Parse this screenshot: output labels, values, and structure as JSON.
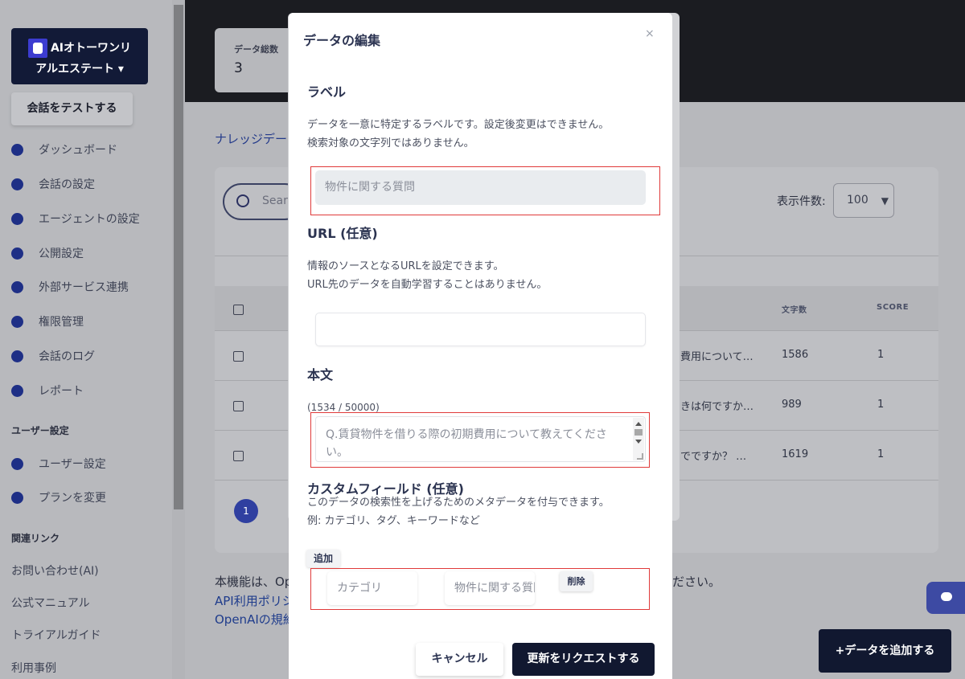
{
  "sidebar": {
    "brand": {
      "line1": "AIオトーワンリ",
      "line2": "アルエステート ▾"
    },
    "test_button": "会話をテストする",
    "items": [
      {
        "label": "ダッシュボード",
        "icon": "pie-chart-icon"
      },
      {
        "label": "会話の設定",
        "icon": "chat-bubble-icon"
      },
      {
        "label": "エージェントの設定",
        "icon": "smiley-icon"
      },
      {
        "label": "公開設定",
        "icon": "globe-icon"
      },
      {
        "label": "外部サービス連携",
        "icon": "link-icon"
      },
      {
        "label": "権限管理",
        "icon": "user-circle-icon"
      },
      {
        "label": "会話のログ",
        "icon": "list-icon"
      },
      {
        "label": "レポート",
        "icon": "compass-icon"
      }
    ],
    "user_section_label": "ユーザー設定",
    "user_items": [
      {
        "label": "ユーザー設定",
        "icon": "bar-chart-icon"
      },
      {
        "label": "プランを変更",
        "icon": "rocket-icon"
      }
    ],
    "related_label": "関連リンク",
    "related_links": [
      "お問い合わせ(AI)",
      "公式マニュアル",
      "トライアルガイド",
      "利用事例"
    ]
  },
  "stats": {
    "label": "データ総数",
    "value": "3"
  },
  "knowledge_title": "ナレッジデー",
  "search": {
    "placeholder": "Sear"
  },
  "per_page": {
    "label": "表示件数:",
    "value": "100"
  },
  "table": {
    "headers": {
      "chars": "文字数",
      "score": "SCORE"
    },
    "rows": [
      {
        "text": "費用について…",
        "chars": "1586",
        "score": "1"
      },
      {
        "text": "きは何ですか…",
        "chars": "989",
        "score": "1"
      },
      {
        "text": "でですか？ …",
        "chars": "1619",
        "score": "1"
      }
    ]
  },
  "pagination": {
    "current": "1"
  },
  "footer": {
    "line1_left": "本機能は、Op",
    "line1_right": "ださい。",
    "link1": "API利用ポリシ",
    "link2": "OpenAIの規約"
  },
  "add_data_button": "+データを追加する",
  "modal": {
    "title": "データの編集",
    "close": "×",
    "label_section": {
      "heading": "ラベル",
      "help1": "データを一意に特定するラベルです。設定後変更はできません。",
      "help2": "検索対象の文字列ではありません。",
      "value": "物件に関する質問"
    },
    "url_section": {
      "heading": "URL (任意)",
      "help1": "情報のソースとなるURLを設定できます。",
      "help2": "URL先のデータを自動学習することはありません。",
      "value": ""
    },
    "body_section": {
      "heading": "本文",
      "count": "(1534 / 50000)",
      "value": "Q.賃貸物件を借りる際の初期費用について教えてください。"
    },
    "custom_section": {
      "heading": "カスタムフィールド (任意)",
      "help1": "このデータの検索性を上げるためのメタデータを付与できます。",
      "help2": "例: カテゴリ、タグ、キーワードなど",
      "add_label": "追加",
      "key_placeholder": "カテゴリ",
      "value": "物件に関する質問",
      "delete_label": "削除"
    },
    "cancel_label": "キャンセル",
    "submit_label": "更新をリクエストする"
  },
  "colors": {
    "primary": "#111830",
    "highlight_box": "#e03a3a",
    "accent": "#2f3fa0"
  }
}
